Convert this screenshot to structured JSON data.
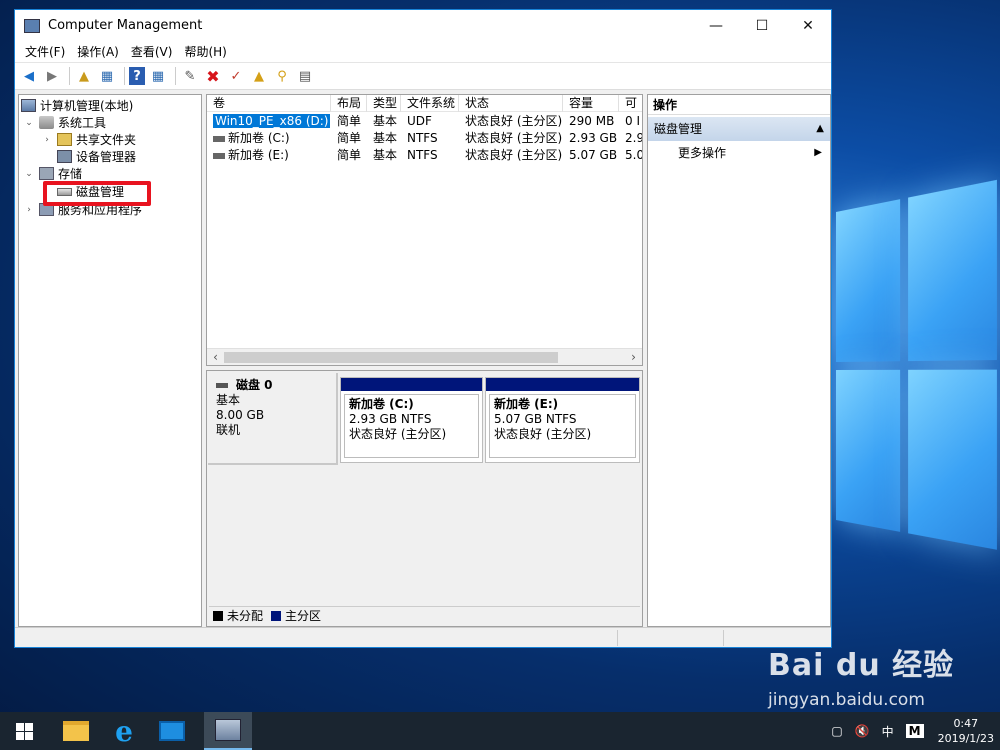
{
  "window": {
    "title": "Computer Management",
    "controls": [
      "—",
      "☐",
      "✕"
    ]
  },
  "menu": [
    "文件(F)",
    "操作(A)",
    "查看(V)",
    "帮助(H)"
  ],
  "tree": {
    "root": "计算机管理(本地)",
    "system_tools": "系统工具",
    "shared_folders": "共享文件夹",
    "device_manager": "设备管理器",
    "storage": "存储",
    "disk_management": "磁盘管理",
    "services": "服务和应用程序"
  },
  "volume_list": {
    "headers": [
      "卷",
      "布局",
      "类型",
      "文件系统",
      "状态",
      "容量",
      "可"
    ],
    "rows": [
      [
        "Win10_PE_x86 (D:)",
        "简单",
        "基本",
        "UDF",
        "状态良好 (主分区)",
        "290 MB",
        "0 I"
      ],
      [
        "新加卷 (C:)",
        "简单",
        "基本",
        "NTFS",
        "状态良好 (主分区)",
        "2.93 GB",
        "2.9"
      ],
      [
        "新加卷 (E:)",
        "简单",
        "基本",
        "NTFS",
        "状态良好 (主分区)",
        "5.07 GB",
        "5.0"
      ]
    ]
  },
  "disk": {
    "name": "磁盘 0",
    "type": "基本",
    "size": "8.00 GB",
    "status": "联机",
    "partitions": [
      {
        "name": "新加卷  (C:)",
        "size": "2.93 GB NTFS",
        "status": "状态良好 (主分区)"
      },
      {
        "name": "新加卷  (E:)",
        "size": "5.07 GB NTFS",
        "status": "状态良好 (主分区)"
      }
    ]
  },
  "legend": {
    "unallocated": "未分配",
    "primary": "主分区",
    "unallocated_color": "#000000",
    "primary_color": "#00157a"
  },
  "actions": {
    "header": "操作",
    "section": "磁盘管理",
    "more": "更多操作"
  },
  "taskbar": {
    "time": "0:47",
    "date": "2019/1/23",
    "ime": "中",
    "ime_mode": "M"
  },
  "watermark": {
    "logo": "Bai du 经验",
    "url": "jingyan.baidu.com"
  },
  "colors": {
    "accent": "#0078d7",
    "highlight_box": "#e8131f",
    "window_border": "#1883d7"
  }
}
